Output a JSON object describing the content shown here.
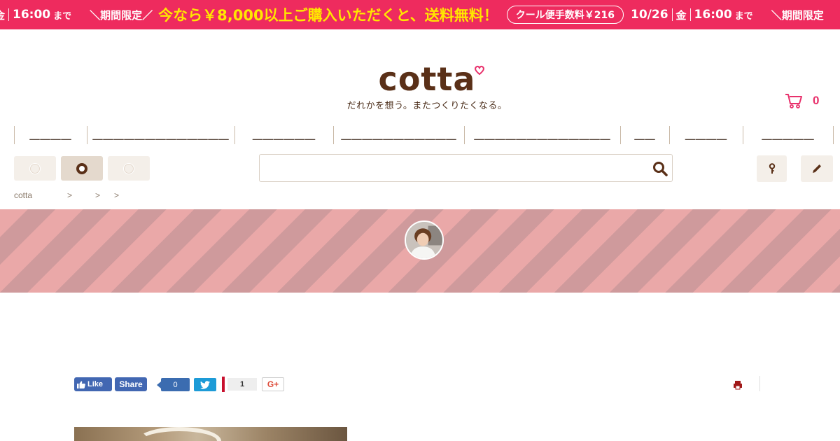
{
  "promo": {
    "start_fragment": "金",
    "time1": "16:00",
    "made1": "まで",
    "limited": "＼期間限定／",
    "headline": "今なら￥8,000以上ご購入いただくと、送料無料！",
    "cool_fee": "クール便手数料￥216",
    "date2": "10/26",
    "day2": "金",
    "time2": "16:00",
    "made2": "まで",
    "limited2": "＼期間限定"
  },
  "header": {
    "logo": "cotta",
    "tagline": "だれかを想う。またつくりたくなる。",
    "cart_count": "0"
  },
  "nav": {
    "items": [
      {
        "label": "＿＿＿＿"
      },
      {
        "label": "＿＿＿＿＿＿＿＿＿＿＿＿＿"
      },
      {
        "label": "＿＿＿＿＿＿"
      },
      {
        "label": "＿＿＿＿＿＿＿＿＿＿＿"
      },
      {
        "label": "＿＿＿＿＿＿＿＿＿＿＿＿＿"
      },
      {
        "label": "＿＿"
      },
      {
        "label": "＿＿＿＿"
      },
      {
        "label": "＿＿＿＿＿"
      }
    ]
  },
  "search": {
    "value": "",
    "placeholder": ""
  },
  "breadcrumb": {
    "home": "cotta",
    "sep1": ">",
    "sep2": ">",
    "sep3": ">"
  },
  "social": {
    "fb_like": "Like",
    "fb_share": "Share",
    "hatena_count": "0",
    "pocket_count": "1",
    "gplus": "G+"
  },
  "colors": {
    "promo_bg": "#ee2b5e",
    "promo_highlight": "#ffe600",
    "brand_brown": "#5a3018",
    "accent_pink": "#e8316c",
    "stripe_light": "#eaa8a8",
    "stripe_dark": "#cf9a9c"
  },
  "icons": {
    "cart": "cart-icon",
    "search": "search-icon",
    "key": "key-icon",
    "pencil": "pencil-icon",
    "print": "print-icon",
    "twitter": "twitter-icon",
    "thumb": "thumbs-up-icon"
  }
}
